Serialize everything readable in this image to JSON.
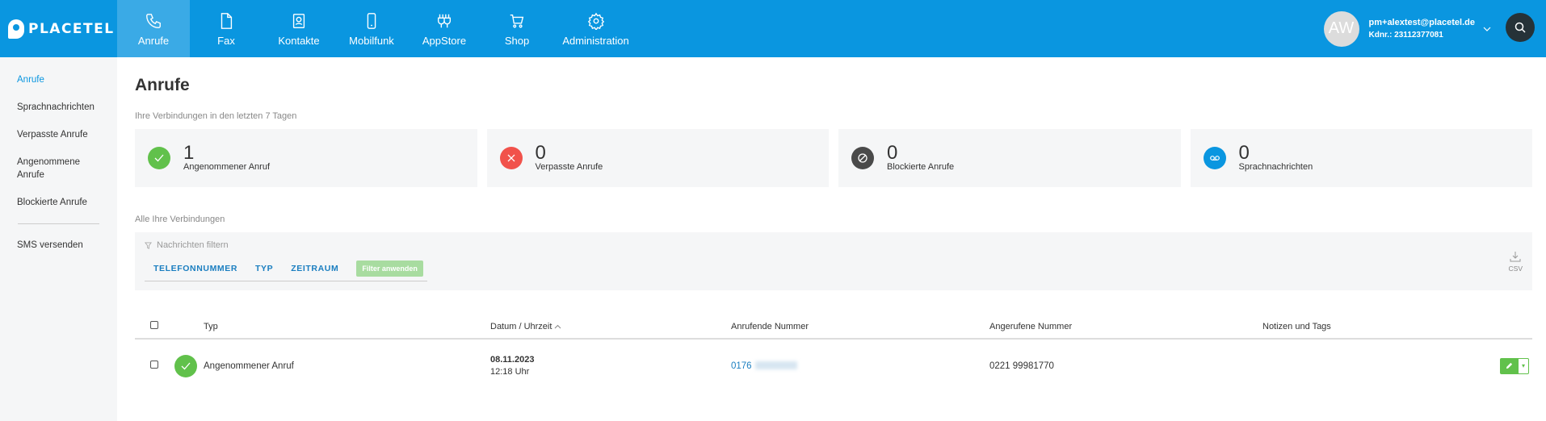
{
  "brand": {
    "name": "PLACETEL"
  },
  "nav": {
    "items": [
      {
        "label": "Anrufe",
        "icon": "phone-icon"
      },
      {
        "label": "Fax",
        "icon": "document-icon"
      },
      {
        "label": "Kontakte",
        "icon": "contact-icon"
      },
      {
        "label": "Mobilfunk",
        "icon": "mobile-icon"
      },
      {
        "label": "AppStore",
        "icon": "plug-icon"
      },
      {
        "label": "Shop",
        "icon": "cart-icon"
      },
      {
        "label": "Administration",
        "icon": "gear-icon"
      }
    ]
  },
  "user": {
    "initials": "AW",
    "email": "pm+alextest@placetel.de",
    "kdnr": "Kdnr.: 23112377081"
  },
  "sidebar": {
    "items": [
      {
        "label": "Anrufe"
      },
      {
        "label": "Sprachnachrichten"
      },
      {
        "label": "Verpasste Anrufe"
      },
      {
        "label": "Angenommene Anrufe"
      },
      {
        "label": "Blockierte Anrufe"
      },
      {
        "label": "SMS versenden"
      }
    ]
  },
  "main": {
    "title": "Anrufe",
    "stats_label": "Ihre Verbindungen in den letzten 7 Tagen",
    "stats": [
      {
        "count": "1",
        "label": "Angenommener Anruf",
        "color": "#61c14b"
      },
      {
        "count": "0",
        "label": "Verpasste Anrufe",
        "color": "#f1524b"
      },
      {
        "count": "0",
        "label": "Blockierte Anrufe",
        "color": "#4a4a4a"
      },
      {
        "count": "0",
        "label": "Sprachnachrichten",
        "color": "#0a96e0"
      }
    ],
    "connections_label": "Alle Ihre Verbindungen",
    "filter": {
      "title": "Nachrichten filtern",
      "options": [
        "TELEFONNUMMER",
        "TYP",
        "ZEITRAUM"
      ],
      "apply_label": "Filter anwenden",
      "csv_label": "CSV"
    },
    "table": {
      "headers": {
        "type": "Typ",
        "date": "Datum / Uhrzeit",
        "caller": "Anrufende Nummer",
        "callee": "Angerufene Nummer",
        "notes": "Notizen und Tags"
      },
      "rows": [
        {
          "type": "Angenommener Anruf",
          "date": "08.11.2023",
          "time": "12:18 Uhr",
          "caller": "0176",
          "callee": "0221 99981770",
          "notes": ""
        }
      ]
    }
  }
}
